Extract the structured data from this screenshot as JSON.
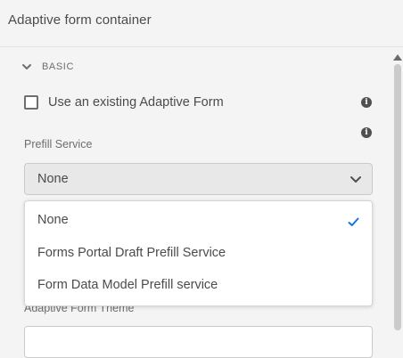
{
  "header": {
    "title": "Adaptive form container"
  },
  "section": {
    "label": "BASIC"
  },
  "existing_form": {
    "label": "Use an existing Adaptive Form",
    "checked": false
  },
  "prefill": {
    "label": "Prefill Service",
    "selected": "None",
    "options": [
      {
        "label": "None",
        "selected": true
      },
      {
        "label": "Forms Portal Draft Prefill Service",
        "selected": false
      },
      {
        "label": "Form Data Model Prefill service",
        "selected": false
      }
    ]
  },
  "theme": {
    "label": "Adaptive Form Theme"
  },
  "colors": {
    "accent_check": "#1473e6",
    "background": "#f4f4f4"
  },
  "icons": {
    "section_toggle": "chevron-down-icon",
    "info": "info-icon",
    "select_toggle": "chevron-down-icon",
    "selected_option": "checkmark-icon",
    "scroll_up": "scroll-up-arrow-icon"
  }
}
